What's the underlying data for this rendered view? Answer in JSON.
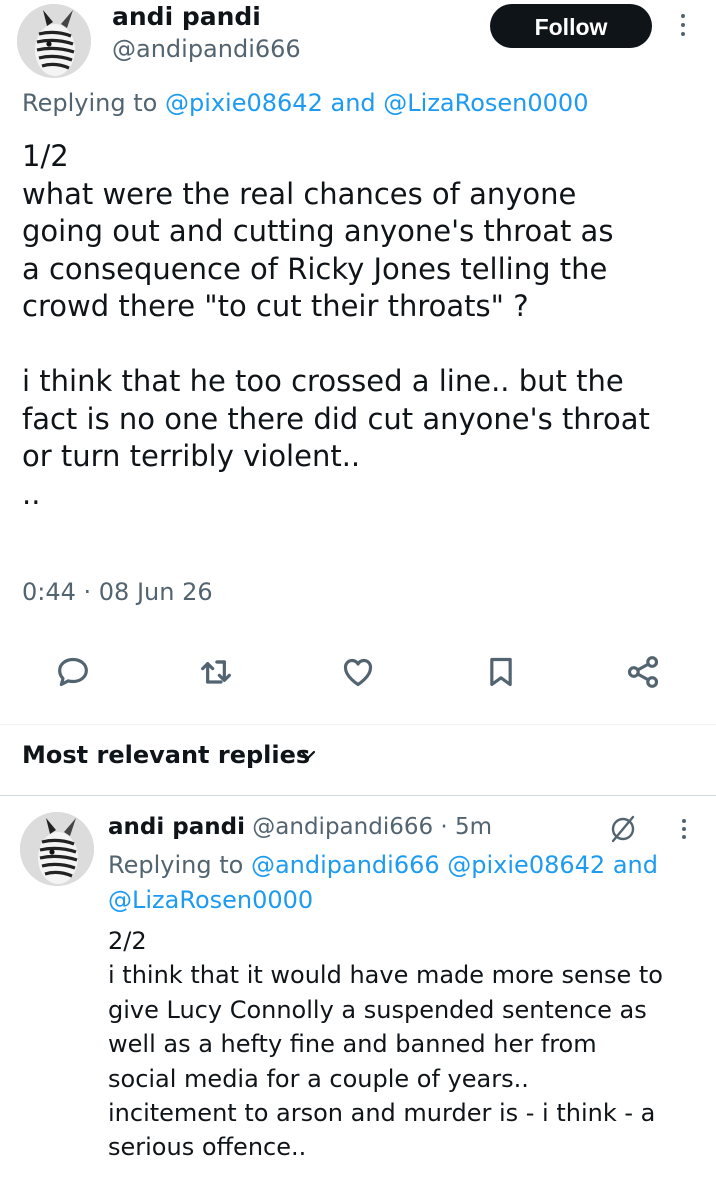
{
  "tweet": {
    "author": {
      "display_name": "andi pandi",
      "handle": "@andipandi666"
    },
    "follow_label": "Follow",
    "replying_prefix": "Replying to",
    "replying_mention_1": "@pixie08642",
    "replying_and": "and",
    "replying_mention_2": "@LizaRosen0000",
    "body_lines": [
      "1/2",
      "what were the real chances of anyone",
      "going out and cutting anyone's throat as",
      "a consequence of Ricky Jones telling the",
      "crowd there \"to cut their throats\" ?",
      "i think that he too crossed a line.. but the",
      "fact is no one there did cut anyone's throat",
      "or turn terribly violent..",
      ".."
    ],
    "timestamp": "0:44 · 08 Jun 26"
  },
  "actions": {
    "icons": [
      "reply-icon",
      "retweet-icon",
      "like-icon",
      "bookmark-icon",
      "share-icon"
    ]
  },
  "replies_section": {
    "sort_label": "Most relevant replies"
  },
  "reply": {
    "author": {
      "display_name": "andi pandi",
      "handle_time": "@andipandi666 · 5m"
    },
    "replying_prefix": "Replying to",
    "replying_mention_1": "@andipandi666",
    "replying_mention_2": "@pixie08642",
    "replying_and": "and",
    "replying_mention_3": "@LizaRosen0000",
    "body_lines": [
      "2/2",
      "i think that it would have made more sense to",
      "give Lucy Connolly a suspended sentence as",
      "well as a hefty fine and banned her from",
      "social media for a couple of years..",
      "incitement to arson and murder is - i think - a",
      "serious offence.."
    ]
  },
  "colors": {
    "text": "#0f1419",
    "secondary": "#536471",
    "link": "#1d9bf0",
    "follow_bg": "#0f1419"
  }
}
